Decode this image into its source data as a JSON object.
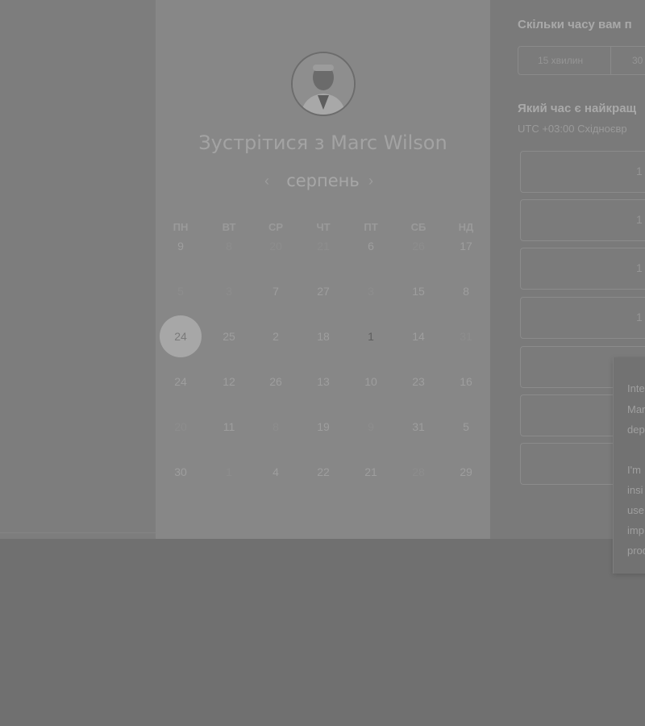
{
  "scheduler": {
    "title": "Зустрітися з Marc Wilson",
    "month": "серпень",
    "prev_icon": "‹",
    "next_icon": "›",
    "weekdays": [
      "ПН",
      "ВТ",
      "СР",
      "ЧТ",
      "ПТ",
      "СБ",
      "НД"
    ],
    "weeks": [
      [
        "9",
        "8",
        "20",
        "21",
        "6",
        "26",
        "17"
      ],
      [
        "5",
        "3",
        "7",
        "27",
        "3",
        "15",
        "8"
      ],
      [
        "24",
        "25",
        "2",
        "18",
        "1",
        "14",
        "31"
      ],
      [
        "24",
        "12",
        "26",
        "13",
        "10",
        "23",
        "16"
      ],
      [
        "20",
        "11",
        "8",
        "19",
        "9",
        "31",
        "5"
      ],
      [
        "30",
        "1",
        "4",
        "22",
        "21",
        "28",
        "29"
      ]
    ],
    "selected_day": "24"
  },
  "options": {
    "duration_question": "Скільки часу вам п",
    "durations": [
      "15 хвилин",
      "30"
    ],
    "time_question": "Який час є найкращ",
    "timezone": "UTC +03:00 Східноєвр",
    "slots": [
      "1",
      "1",
      "1",
      "1",
      "",
      "",
      ""
    ]
  },
  "popover": {
    "lines": [
      "Inte",
      "Mar",
      "dep",
      "",
      "I'm",
      "insi",
      "use",
      "imp",
      "prod"
    ]
  },
  "colors": {
    "overlay_background": "#707070",
    "card_background": "#878787",
    "selected_day_fill": "#a7a7a7"
  }
}
